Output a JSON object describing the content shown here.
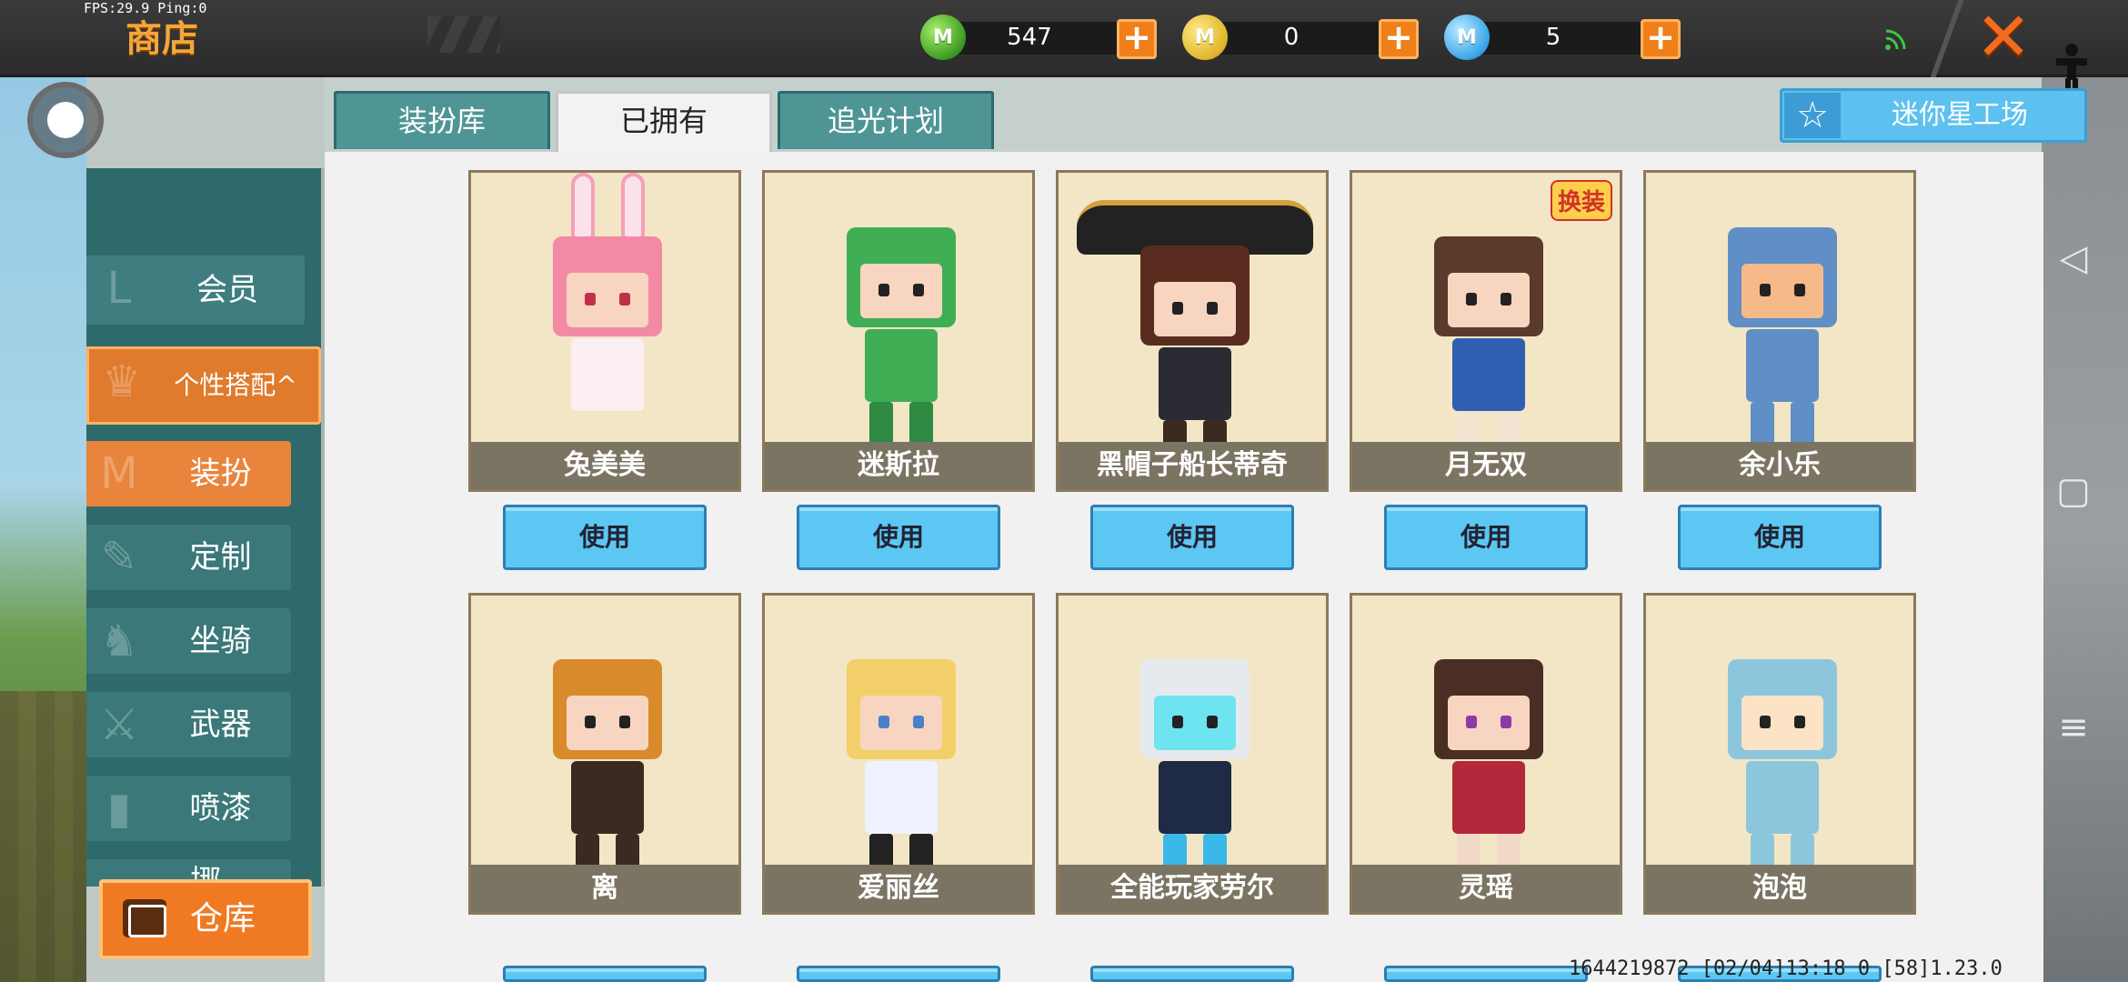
{
  "status": {
    "fps_text": "FPS:29.9  Ping:0"
  },
  "header": {
    "title": "商店",
    "currencies": [
      {
        "icon": "green-mini-coin-icon",
        "symbol": "M",
        "value": "547"
      },
      {
        "icon": "gold-mini-coin-icon",
        "symbol": "M",
        "value": "0"
      },
      {
        "icon": "blue-mini-coin-icon",
        "symbol": "M",
        "value": "5"
      }
    ],
    "plus_symbol": "+",
    "close_symbol": "✕"
  },
  "tabs": [
    {
      "label": "装扮库",
      "active": false
    },
    {
      "label": "已拥有",
      "active": true
    },
    {
      "label": "追光计划",
      "active": false
    }
  ],
  "workshop_button": {
    "label": "迷你星工场",
    "icon": "star-icon"
  },
  "sidebar": {
    "items": [
      {
        "label": "会员",
        "type": "item"
      },
      {
        "label": "个性搭配^",
        "type": "group"
      },
      {
        "label": "装扮",
        "type": "sub",
        "active": true
      },
      {
        "label": "定制",
        "type": "sub"
      },
      {
        "label": "坐骑",
        "type": "sub"
      },
      {
        "label": "武器",
        "type": "sub"
      },
      {
        "label": "喷漆",
        "type": "sub"
      },
      {
        "label": "挪...",
        "type": "sub"
      }
    ],
    "warehouse_label": "仓库"
  },
  "grid": {
    "use_label": "使用",
    "badge_label": "换装",
    "row1": [
      "兔美美",
      "迷斯拉",
      "黑帽子船长蒂奇",
      "月无双",
      "余小乐"
    ],
    "row2": [
      "离",
      "爱丽丝",
      "全能玩家劳尔",
      "灵瑶",
      "泡泡"
    ]
  },
  "footer": {
    "info": "1644219872   [02/04]13:18 0   [58]1.23.0"
  },
  "colors": {
    "accent_orange": "#f07a24",
    "teal": "#3e7e80",
    "button_blue": "#5cc7f2"
  }
}
